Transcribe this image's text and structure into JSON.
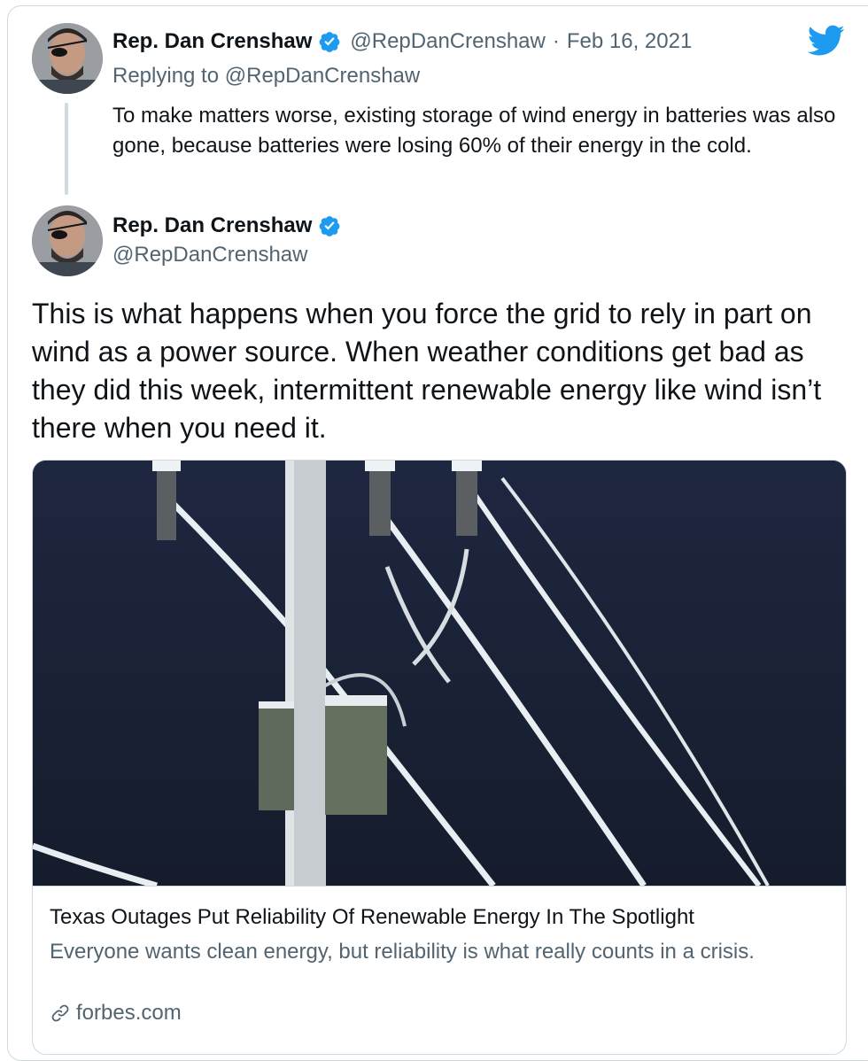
{
  "reply_tweet": {
    "author_name": "Rep. Dan Crenshaw",
    "author_handle": "@RepDanCrenshaw",
    "separator": "·",
    "date": "Feb 16, 2021",
    "replying_prefix": "Replying to ",
    "replying_to": "@RepDanCrenshaw",
    "text": "To make matters worse, existing storage of wind energy in batteries was also gone, because batteries were losing 60% of their energy in the cold."
  },
  "main_tweet": {
    "author_name": "Rep. Dan Crenshaw",
    "author_handle": "@RepDanCrenshaw",
    "text": "This is what happens when you force the grid to rely in part on wind as a power source. When weather conditions get bad as they did this week, intermittent renewable energy like wind isn’t there when you need it."
  },
  "link_card": {
    "title": "Texas Outages Put Reliability Of Renewable Energy In The Spotlight",
    "description": "Everyone wants clean energy, but reliability is what really counts in a crisis.",
    "domain": "forbes.com"
  },
  "icons": {
    "brand": "twitter-bird-icon",
    "verified": "verified-badge-icon",
    "link": "link-icon"
  },
  "colors": {
    "twitter_blue": "#1d9bf0",
    "secondary_text": "#536471",
    "border": "#cfd9de"
  }
}
